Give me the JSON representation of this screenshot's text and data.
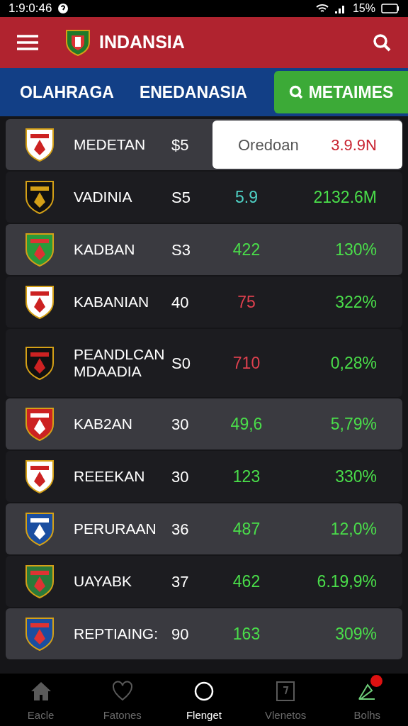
{
  "status_bar": {
    "time": "1:9:0:46",
    "battery": "15%"
  },
  "app_bar": {
    "title": "INDANSIA"
  },
  "tabs": [
    {
      "label": "OLAHRAGA"
    },
    {
      "label": "ENEDANASIA"
    }
  ],
  "action_button": {
    "label": "METAIMES"
  },
  "rows": [
    {
      "kind": "popup",
      "name": "MEDETAN",
      "col2": "$5",
      "highlighted": true,
      "popup_label": "Oredoan",
      "popup_value": "3.9.9N"
    },
    {
      "kind": "plain",
      "name": "VADINIA",
      "col2": "S5",
      "col3": "5.9",
      "color": "#4fd1c5",
      "col4": "2132.6M",
      "highlighted": false
    },
    {
      "kind": "plain",
      "name": "KADBAN",
      "col2": "S3",
      "col3": "422",
      "color": "#4ade4a",
      "col4": "130%",
      "highlighted": true
    },
    {
      "kind": "plain",
      "name": "KABANIAN",
      "col2": "40",
      "col3": "75",
      "color": "#e0414f",
      "col4": "322%",
      "highlighted": false
    },
    {
      "kind": "plain",
      "name": "PEANDLCAN MDAADIA",
      "col2": "S0",
      "col3": "710",
      "color": "#e0414f",
      "col4": "0,28%",
      "highlighted": false
    },
    {
      "kind": "plain",
      "name": "KAB2AN",
      "col2": "30",
      "col3": "49,6",
      "color": "#4ade4a",
      "col4": "5,79%",
      "highlighted": true
    },
    {
      "kind": "plain",
      "name": "REEEKAN",
      "col2": "30",
      "col3": "123",
      "color": "#4ade4a",
      "col4": "330%",
      "highlighted": false
    },
    {
      "kind": "plain",
      "name": "PERURAAN",
      "col2": "36",
      "col3": "487",
      "color": "#4ade4a",
      "col4": "12,0%",
      "highlighted": true
    },
    {
      "kind": "plain",
      "name": "UAYABK",
      "col2": "37",
      "col3": "462",
      "color": "#4ade4a",
      "col4": "6.19,9%",
      "highlighted": false
    },
    {
      "kind": "plain",
      "name": "REPTIAING:",
      "col2": "90",
      "col3": "163",
      "color": "#4ade4a",
      "col4": "309%",
      "highlighted": true
    }
  ],
  "bottom_nav": [
    {
      "label": "Eacle",
      "selected": false,
      "badge": false
    },
    {
      "label": "Fatones",
      "selected": false,
      "badge": false
    },
    {
      "label": "Flenget",
      "selected": true,
      "badge": false
    },
    {
      "label": "Vlenetos",
      "selected": false,
      "badge": false
    },
    {
      "label": "Bolhs",
      "selected": false,
      "badge": true
    }
  ]
}
